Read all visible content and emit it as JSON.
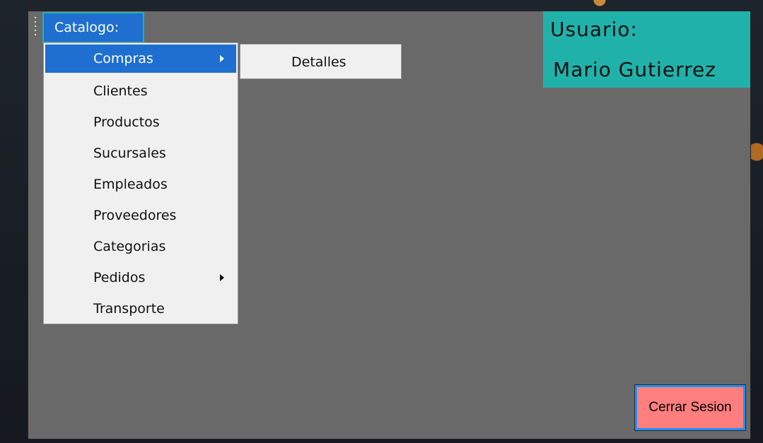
{
  "menubar": {
    "catalogo_label": "Catalogo:"
  },
  "dropdown": {
    "items": [
      {
        "label": "Compras",
        "has_submenu": true,
        "selected": true
      },
      {
        "label": "Clientes",
        "has_submenu": false
      },
      {
        "label": "Productos",
        "has_submenu": false
      },
      {
        "label": "Sucursales",
        "has_submenu": false
      },
      {
        "label": "Empleados",
        "has_submenu": false
      },
      {
        "label": "Proveedores",
        "has_submenu": false
      },
      {
        "label": "Categorias",
        "has_submenu": false
      },
      {
        "label": "Pedidos",
        "has_submenu": true
      },
      {
        "label": "Transporte",
        "has_submenu": false
      }
    ]
  },
  "submenu": {
    "items": [
      {
        "label": "Detalles"
      }
    ]
  },
  "user_panel": {
    "label": "Usuario:",
    "name": "Mario Gutierrez"
  },
  "logout": {
    "label": "Cerrar Sesion"
  },
  "colors": {
    "window_bg": "#696969",
    "menu_highlight": "#1e6fcf",
    "user_panel_bg": "#20b2aa",
    "logout_bg": "#ff7f7f",
    "logout_border": "#1e90ff"
  }
}
